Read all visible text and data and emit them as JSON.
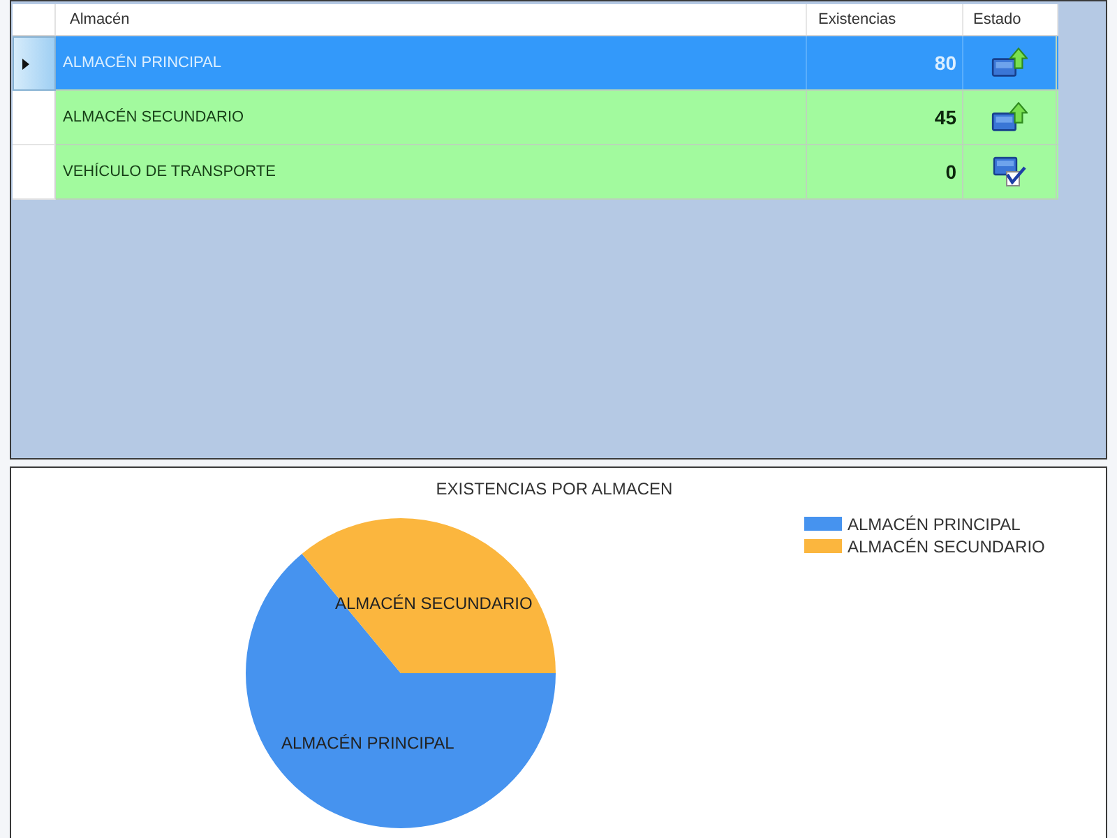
{
  "table": {
    "columns": [
      "Almacén",
      "Existencias",
      "Estado"
    ],
    "rows": [
      {
        "almacen": "ALMACÉN PRINCIPAL",
        "existencias": "80",
        "kind": "arrow",
        "selected": true
      },
      {
        "almacen": "ALMACÉN SECUNDARIO",
        "existencias": "45",
        "kind": "arrow",
        "selected": false
      },
      {
        "almacen": "VEHÍCULO DE TRANSPORTE",
        "existencias": "0",
        "kind": "check",
        "selected": false
      }
    ]
  },
  "chart": {
    "chart_data": {
      "type": "pie",
      "title": "EXISTENCIAS POR ALMACEN",
      "categories": [
        "ALMACÉN PRINCIPAL",
        "ALMACÉN SECUNDARIO"
      ],
      "values": [
        64,
        36
      ]
    },
    "legend": [
      {
        "label": "ALMACÉN PRINCIPAL",
        "color": "#4693ef"
      },
      {
        "label": "ALMACÉN SECUNDARIO",
        "color": "#fbb63e"
      }
    ]
  }
}
